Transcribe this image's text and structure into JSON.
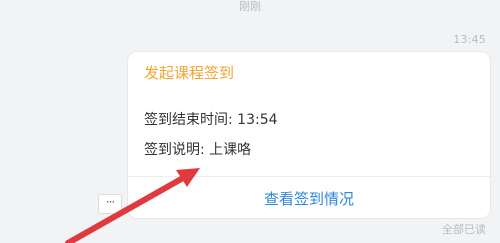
{
  "chat": {
    "top_timestamp": "刚刚",
    "message_time": "13:45",
    "read_status": "全部已读",
    "more_label": "···"
  },
  "checkin_card": {
    "title": "发起课程签到",
    "end_time_line": "签到结束时间: 13:54",
    "description_line": "签到说明: 上课咯",
    "action_label": "查看签到情况"
  },
  "colors": {
    "title": "#f0a630",
    "action": "#2e86de",
    "annotation_arrow": "#e0393e"
  },
  "icons": {
    "annotation": "red-arrow-icon"
  }
}
